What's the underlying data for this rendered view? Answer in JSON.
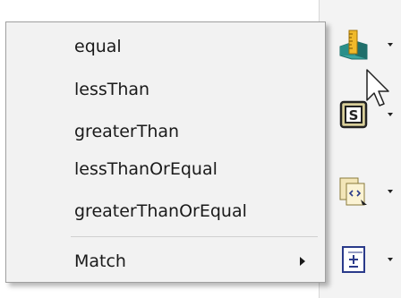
{
  "context_menu": {
    "items": [
      {
        "label": "equal"
      },
      {
        "label": "lessThan"
      },
      {
        "label": "greaterThan"
      },
      {
        "label": "lessThanOrEqual"
      },
      {
        "label": "greaterThanOrEqual"
      }
    ],
    "submenu": {
      "label": "Match",
      "has_submenu": true
    }
  },
  "toolbar": {
    "buttons": [
      {
        "icon": "measure-ruler-icon"
      },
      {
        "icon": "s-stamp-icon"
      },
      {
        "icon": "code-document-icon"
      },
      {
        "icon": "plus-minus-box-icon"
      }
    ]
  },
  "colors": {
    "menu_background": "#f2f2f2",
    "menu_border": "#a0a0a0",
    "toolbar_background": "#f3f3f3",
    "text": "#1a1a1a"
  }
}
